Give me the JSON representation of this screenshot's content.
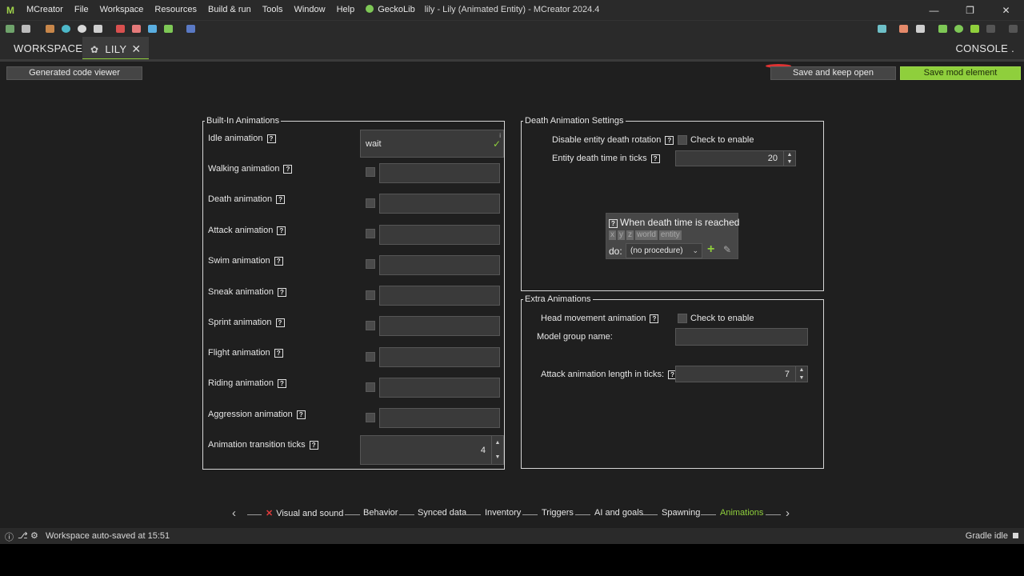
{
  "window": {
    "title": "lily - Lily (Animated Entity) - MCreator 2024.4",
    "logo": "M"
  },
  "menu": [
    "MCreator",
    "File",
    "Workspace",
    "Resources",
    "Build & run",
    "Tools",
    "Window",
    "Help",
    "GeckoLib"
  ],
  "tabs": {
    "workspace": "WORKSPACE",
    "lily": "LILY",
    "console": "CONSOLE"
  },
  "buttons": {
    "code_viewer": "Generated code viewer",
    "save_keep_open": "Save and keep open",
    "save_mod_element": "Save mod element"
  },
  "builtin": {
    "legend": "Built-In Animations",
    "idle_label": "Idle animation",
    "idle_value": "wait",
    "rows": [
      "Walking animation",
      "Death animation",
      "Attack animation",
      "Swim animation",
      "Sneak animation",
      "Sprint animation",
      "Flight animation",
      "Riding animation",
      "Aggression animation"
    ],
    "transition_label": "Animation transition ticks",
    "transition_value": "4"
  },
  "death": {
    "legend": "Death Animation Settings",
    "disable_rotation_label": "Disable entity death rotation",
    "disable_rotation_check": "Check to enable",
    "death_time_label": "Entity death time in ticks",
    "death_time_value": "20",
    "procedure_title": "When death time is reached",
    "procedure_deps": [
      "x",
      "y",
      "z",
      "world",
      "entity"
    ],
    "procedure_do": "do:",
    "procedure_value": "(no procedure)"
  },
  "extra": {
    "legend": "Extra Animations",
    "head_label": "Head movement animation",
    "head_check": "Check to enable",
    "model_group_label": "Model group name:",
    "attack_length_label": "Attack animation length in ticks:",
    "attack_length_value": "7"
  },
  "wizard": {
    "steps": [
      "Visual and sound",
      "Behavior",
      "Synced data",
      "Inventory",
      "Triggers",
      "AI and goals",
      "Spawning",
      "Animations"
    ],
    "error_step": "Visual and sound",
    "active_step": "Animations"
  },
  "status": {
    "left": "Workspace auto-saved at 15:51",
    "right": "Gradle idle"
  },
  "colors": {
    "accent": "#8fcf3c",
    "error": "#e23b3b",
    "background": "#1f1f1f"
  }
}
